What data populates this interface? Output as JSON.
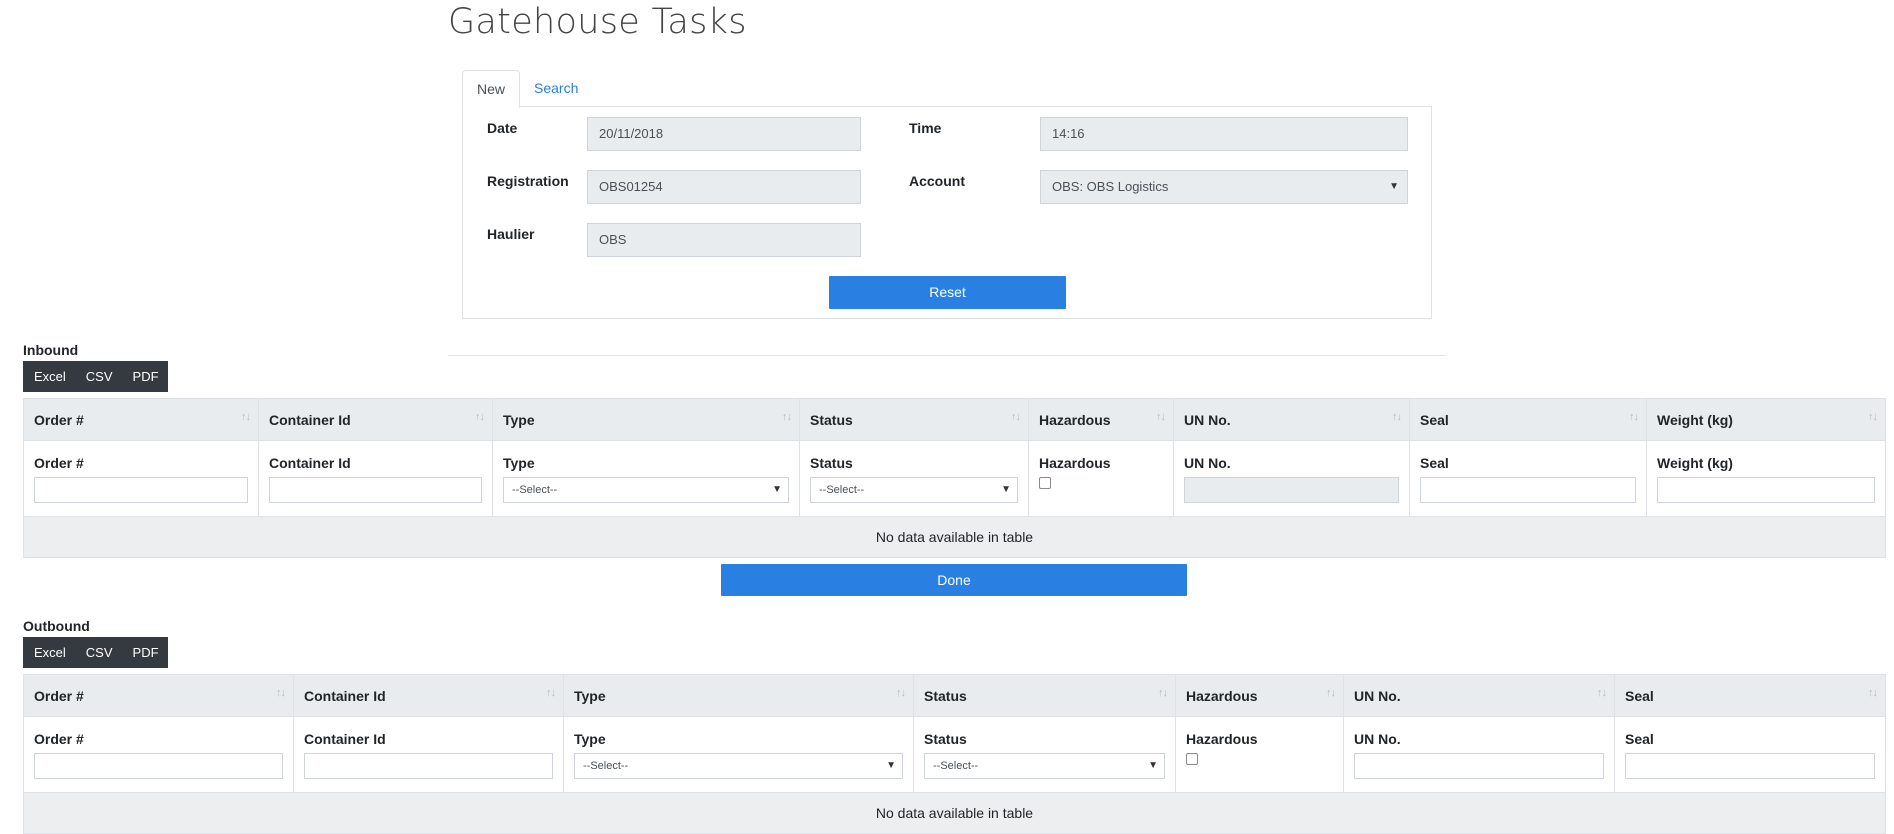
{
  "page": {
    "title": "Gatehouse Tasks"
  },
  "tabs": [
    {
      "label": "New",
      "active": true
    },
    {
      "label": "Search",
      "active": false
    }
  ],
  "form": {
    "date": {
      "label": "Date",
      "value": "20/11/2018"
    },
    "time": {
      "label": "Time",
      "value": "14:16"
    },
    "registration": {
      "label": "Registration",
      "value": "OBS01254"
    },
    "account": {
      "label": "Account",
      "value": "OBS: OBS Logistics"
    },
    "haulier": {
      "label": "Haulier",
      "value": "OBS"
    },
    "reset_label": "Reset"
  },
  "export_buttons": [
    "Excel",
    "CSV",
    "PDF"
  ],
  "inbound": {
    "label": "Inbound",
    "columns": [
      "Order #",
      "Container Id",
      "Type",
      "Status",
      "Hazardous",
      "UN No.",
      "Seal",
      "Weight (kg)"
    ],
    "select_placeholder": "--Select--",
    "empty_message": "No data available in table",
    "done_label": "Done"
  },
  "outbound": {
    "label": "Outbound",
    "columns": [
      "Order #",
      "Container Id",
      "Type",
      "Status",
      "Hazardous",
      "UN No.",
      "Seal"
    ],
    "select_placeholder": "--Select--",
    "empty_message": "No data available in table"
  },
  "icons": {
    "sort": "sort-arrows-icon",
    "dropdown": "caret-down-icon",
    "checkbox": "checkbox-icon"
  },
  "colors": {
    "primary": "#2a80e2",
    "dark": "#343a40",
    "link": "#2b7fd8"
  }
}
